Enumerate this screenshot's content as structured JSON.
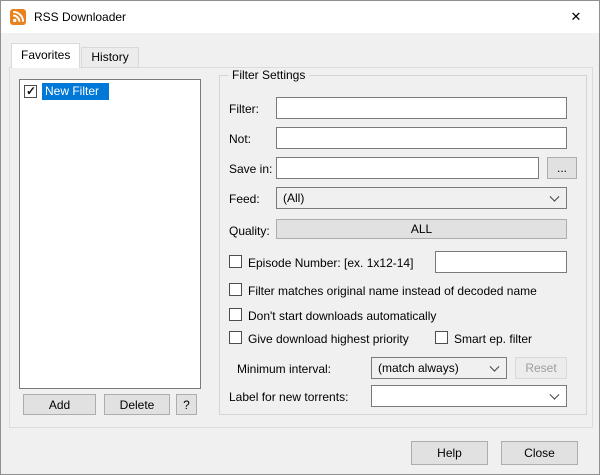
{
  "window": {
    "title": "RSS Downloader",
    "close_glyph": "✕"
  },
  "tabs": [
    {
      "label": "Favorites"
    },
    {
      "label": "History"
    }
  ],
  "filter_list": {
    "items": [
      {
        "label": "New Filter",
        "checked": true,
        "selected": true
      }
    ],
    "buttons": {
      "add": "Add",
      "delete": "Delete",
      "help": "?"
    }
  },
  "filter_settings": {
    "group_title": "Filter Settings",
    "filter": {
      "label": "Filter:",
      "value": ""
    },
    "not": {
      "label": "Not:",
      "value": ""
    },
    "save_in": {
      "label": "Save in:",
      "value": "",
      "browse": "..."
    },
    "feed": {
      "label": "Feed:",
      "value": "(All)"
    },
    "quality": {
      "label": "Quality:",
      "value": "ALL"
    },
    "episode": {
      "label": "Episode Number: [ex. 1x12-14]",
      "value": ""
    },
    "original_name": {
      "label": "Filter matches original name instead of decoded name"
    },
    "dont_start": {
      "label": "Don't start downloads automatically"
    },
    "highest_priority": {
      "label": "Give download highest priority"
    },
    "smart_ep": {
      "label": "Smart ep. filter"
    },
    "minimum_interval": {
      "label": "Minimum interval:",
      "value": "(match always)",
      "reset": "Reset"
    },
    "torrent_label": {
      "label": "Label for new torrents:",
      "value": ""
    }
  },
  "footer": {
    "help": "Help",
    "close": "Close"
  }
}
